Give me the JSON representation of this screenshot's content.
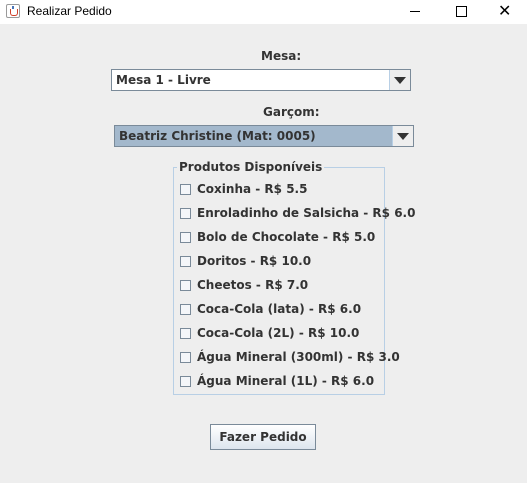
{
  "window": {
    "title": "Realizar Pedido",
    "controls": {
      "minimize": "minimize",
      "maximize": "maximize",
      "close": "✕"
    }
  },
  "mesa": {
    "label": "Mesa:",
    "selected": "Mesa 1 - Livre"
  },
  "garcom": {
    "label": "Garçom:",
    "selected": "Beatriz Christine (Mat: 0005)"
  },
  "produtos": {
    "title": "Produtos Disponíveis",
    "items": [
      {
        "label": "Coxinha - R$ 5.5",
        "checked": false
      },
      {
        "label": "Enroladinho de Salsicha - R$ 6.0",
        "checked": false
      },
      {
        "label": "Bolo de Chocolate - R$ 5.0",
        "checked": false
      },
      {
        "label": "Doritos - R$ 10.0",
        "checked": false
      },
      {
        "label": "Cheetos - R$ 7.0",
        "checked": false
      },
      {
        "label": "Coca-Cola (lata) - R$ 6.0",
        "checked": false
      },
      {
        "label": "Coca-Cola (2L) - R$ 10.0",
        "checked": false
      },
      {
        "label": "Água Mineral (300ml) - R$ 3.0",
        "checked": false
      },
      {
        "label": "Água Mineral (1L) - R$ 6.0",
        "checked": false
      }
    ]
  },
  "actions": {
    "submit_label": "Fazer Pedido"
  },
  "icons": {
    "app": "java-cup-icon",
    "combo_arrow": "chevron-down-icon"
  },
  "colors": {
    "background": "#eeeeee",
    "selected_combo": "#a3b8cc",
    "border": "#7a8a99"
  }
}
